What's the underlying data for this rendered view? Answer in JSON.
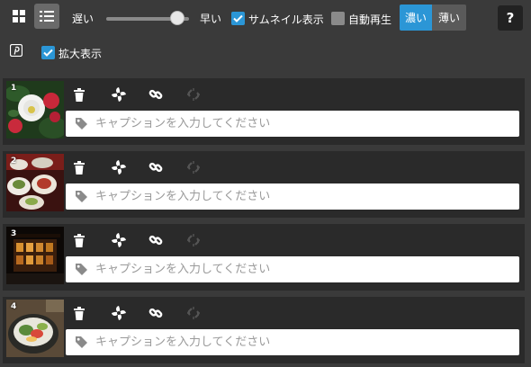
{
  "toolbar": {
    "speed_slow": "遅い",
    "speed_fast": "早い",
    "thumbnail_label": "サムネイル表示",
    "thumbnail_checked": true,
    "autoplay_label": "自動再生",
    "autoplay_checked": false,
    "theme_dark": "濃い",
    "theme_light": "薄い",
    "help_label": "?",
    "speed_value": 0.86
  },
  "second_row": {
    "zoom_label": "拡大表示",
    "zoom_checked": true
  },
  "items": [
    {
      "num": "1",
      "placeholder": "キャプションを入力してください"
    },
    {
      "num": "2",
      "placeholder": "キャプションを入力してください"
    },
    {
      "num": "3",
      "placeholder": "キャプションを入力してください"
    },
    {
      "num": "4",
      "placeholder": "キャプションを入力してください"
    }
  ],
  "colors": {
    "accent": "#2b96d6",
    "background": "#3a3a3a",
    "row_background": "#2a2a2a"
  }
}
